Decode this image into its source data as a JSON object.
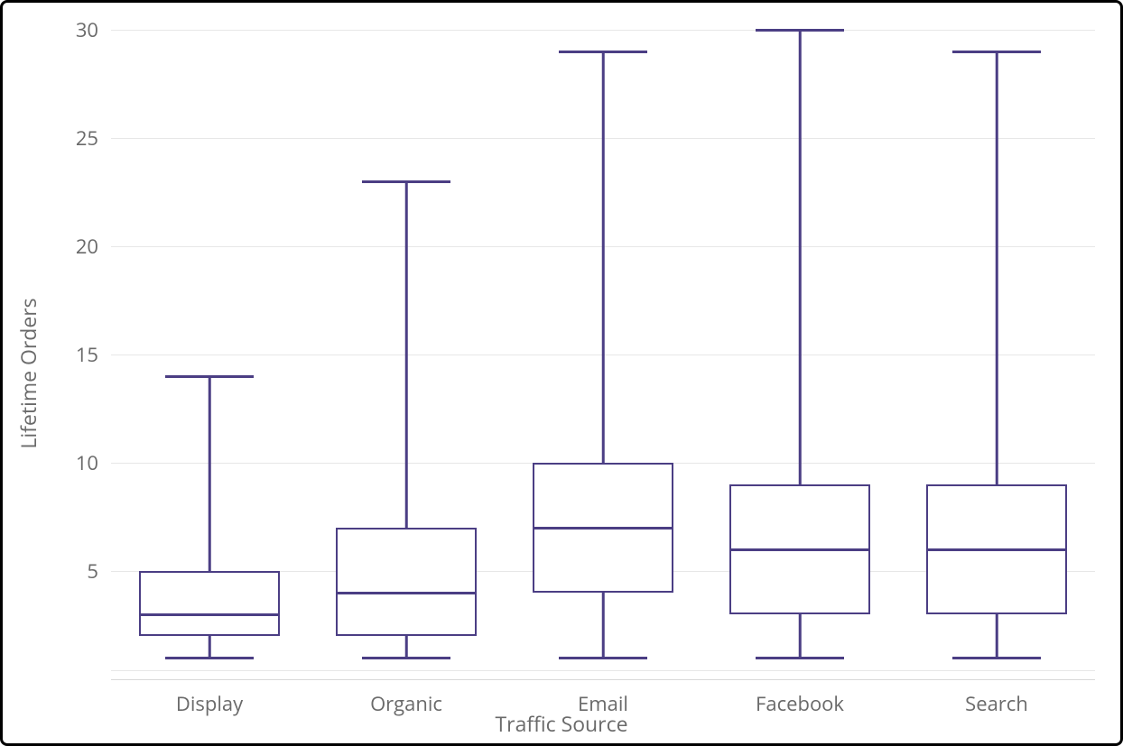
{
  "chart_data": {
    "type": "boxplot",
    "xlabel": "Traffic Source",
    "ylabel": "Lifetime Orders",
    "ylim": [
      0,
      30
    ],
    "y_ticks": [
      5,
      10,
      15,
      20,
      25,
      30
    ],
    "categories": [
      "Display",
      "Organic",
      "Email",
      "Facebook",
      "Search"
    ],
    "series": [
      {
        "name": "Display",
        "min": 1,
        "q1": 2,
        "median": 3,
        "q3": 5,
        "max": 14
      },
      {
        "name": "Organic",
        "min": 1,
        "q1": 2,
        "median": 4,
        "q3": 7,
        "max": 23
      },
      {
        "name": "Email",
        "min": 1,
        "q1": 4,
        "median": 7,
        "q3": 10,
        "max": 29
      },
      {
        "name": "Facebook",
        "min": 1,
        "q1": 3,
        "median": 6,
        "q3": 9,
        "max": 30
      },
      {
        "name": "Search",
        "min": 1,
        "q1": 3,
        "median": 6,
        "q3": 9,
        "max": 29
      }
    ],
    "color": "#4b3e84"
  }
}
